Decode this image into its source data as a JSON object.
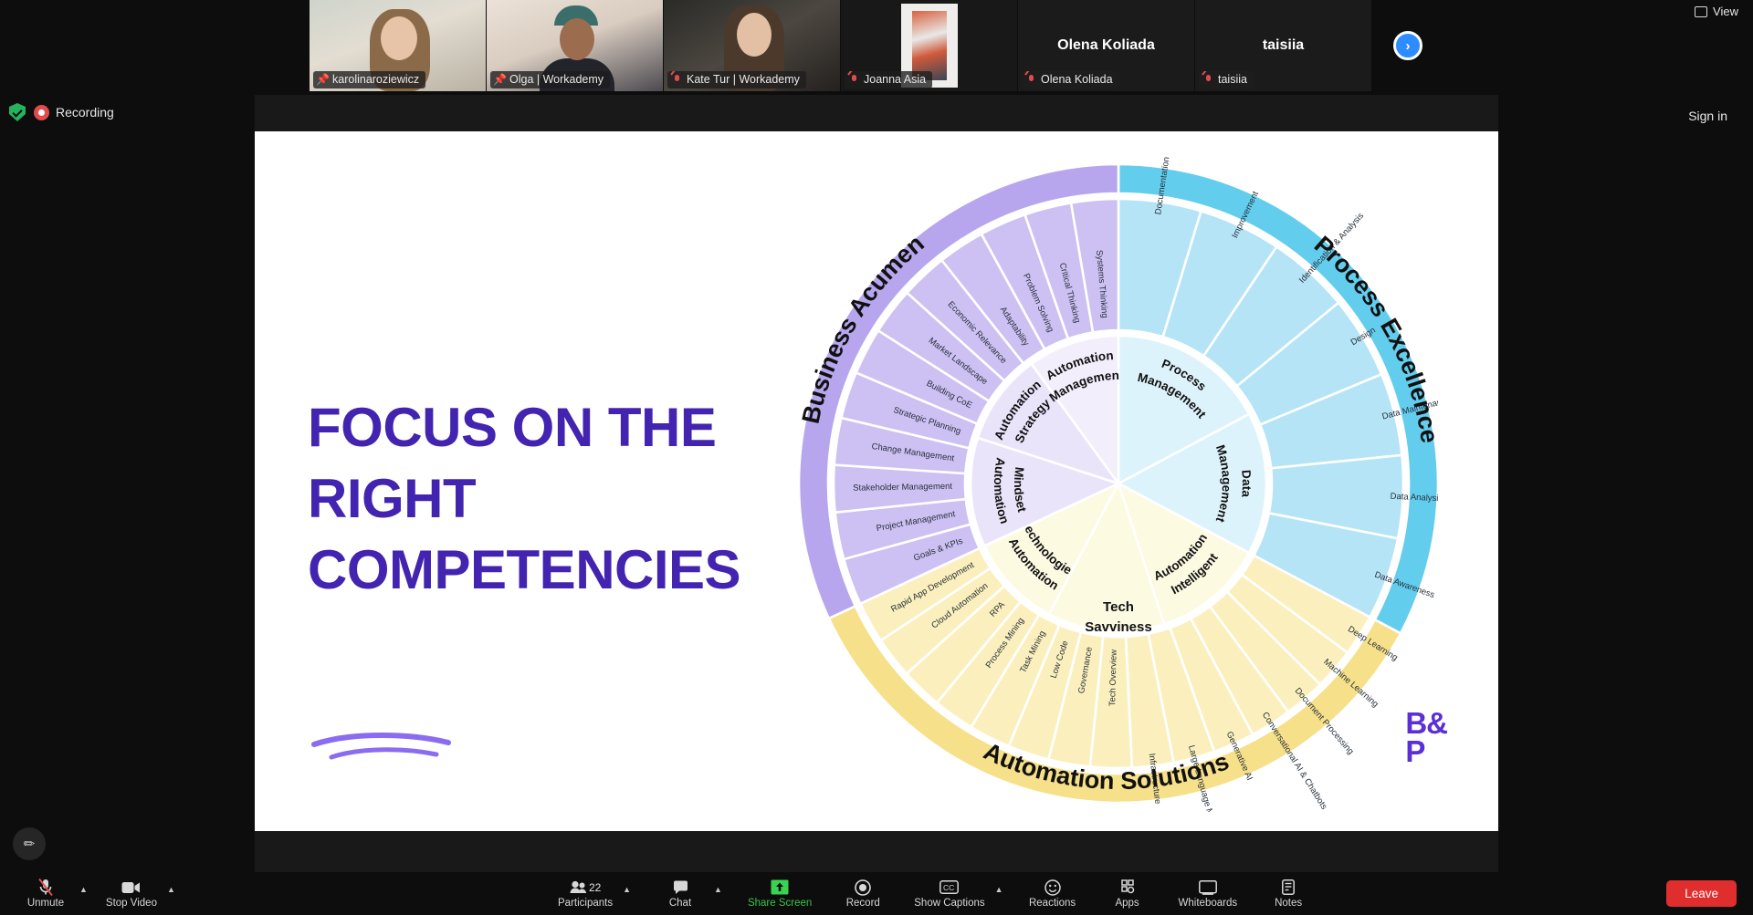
{
  "meeting": {
    "recording_label": "Recording",
    "sign_in_label": "Sign in",
    "view_label": "View",
    "participant_count": "22"
  },
  "filmstrip": {
    "tiles": [
      {
        "name": "karolinaroziewicz",
        "icon": "pin-icon",
        "muted": false,
        "has_video": true,
        "active_speaker": true
      },
      {
        "name": "Olga | Workademy",
        "icon": "pin-icon",
        "muted": false,
        "has_video": true,
        "active_speaker": true
      },
      {
        "name": "Kate Tur | Workademy",
        "icon": "mic-muted-icon",
        "muted": true,
        "has_video": true,
        "active_speaker": false
      },
      {
        "name": "Joanna Asia",
        "icon": "mic-muted-icon",
        "muted": true,
        "has_video": true,
        "active_speaker": false
      },
      {
        "name": "Olena Koliada",
        "icon": "mic-muted-icon",
        "muted": true,
        "has_video": false,
        "active_speaker": false
      },
      {
        "name": "taisiia",
        "icon": "mic-muted-icon",
        "muted": true,
        "has_video": false,
        "active_speaker": false
      }
    ],
    "next_arrow": "›"
  },
  "slide": {
    "title_lines": [
      "FOCUS ON THE",
      "RIGHT",
      "COMPETENCIES"
    ],
    "brand_line1": "B&",
    "brand_line2": "P",
    "accent_color": "#4224b0",
    "center_label_line1": "Tech",
    "center_label_line2": "Savviness",
    "quadrants": [
      {
        "name": "Business Acumen",
        "color": "#b7a6ee",
        "ring_color": "#cdc0f3"
      },
      {
        "name": "Process Excellence",
        "color": "#63cdee",
        "ring_color": "#b4e4f6"
      },
      {
        "name": "Automation Solutions",
        "color": "#f7e08a",
        "ring_color": "#fbf0bd"
      }
    ],
    "inner_ring": [
      "Automation Management",
      "Process Management",
      "Data Management",
      "Intelligent Automation",
      "Automation Technologies",
      "Automation Mindset",
      "Automation Strategy"
    ],
    "outer_ring": {
      "business_acumen": [
        "Goals & KPIs",
        "Project Management",
        "Stakeholder Management",
        "Change Management",
        "Strategic Planning",
        "Building CoE",
        "Market Landscape",
        "Economic Relevance",
        "Adaptability",
        "Problem Solving",
        "Critical Thinking",
        "Systems Thinking"
      ],
      "process_excellence": [
        "Documentation",
        "Improvement",
        "Identification & Analysis",
        "Design",
        "Data Maintenance",
        "Data Analysis",
        "Data Awareness"
      ],
      "automation_solutions": [
        "Deep Learning",
        "Machine Learning",
        "Document Processing",
        "Conversational AI & Chatbots",
        "Generative AI",
        "Large Language Models",
        "Infrastructure",
        "Tech Overview",
        "Governance",
        "Low Code",
        "Task Mining",
        "Process Mining",
        "RPA",
        "Cloud Automation",
        "Rapid App Development"
      ]
    }
  },
  "toolbar": {
    "left": [
      {
        "label": "Unmute",
        "icon": "mic-muted-icon",
        "caret": true
      },
      {
        "label": "Stop Video",
        "icon": "video-icon",
        "caret": true
      }
    ],
    "center": [
      {
        "label": "Participants",
        "icon": "participants-icon",
        "caret": true,
        "badge": "22"
      },
      {
        "label": "Chat",
        "icon": "chat-icon",
        "caret": true
      },
      {
        "label": "Share Screen",
        "icon": "share-screen-icon",
        "caret": false,
        "highlight": true
      },
      {
        "label": "Record",
        "icon": "record-icon",
        "caret": false
      },
      {
        "label": "Show Captions",
        "icon": "captions-icon",
        "caret": true
      },
      {
        "label": "Reactions",
        "icon": "reactions-icon",
        "caret": false
      },
      {
        "label": "Apps",
        "icon": "apps-icon",
        "caret": false
      },
      {
        "label": "Whiteboards",
        "icon": "whiteboard-icon",
        "caret": false
      },
      {
        "label": "Notes",
        "icon": "notes-icon",
        "caret": false
      }
    ],
    "leave_label": "Leave"
  }
}
